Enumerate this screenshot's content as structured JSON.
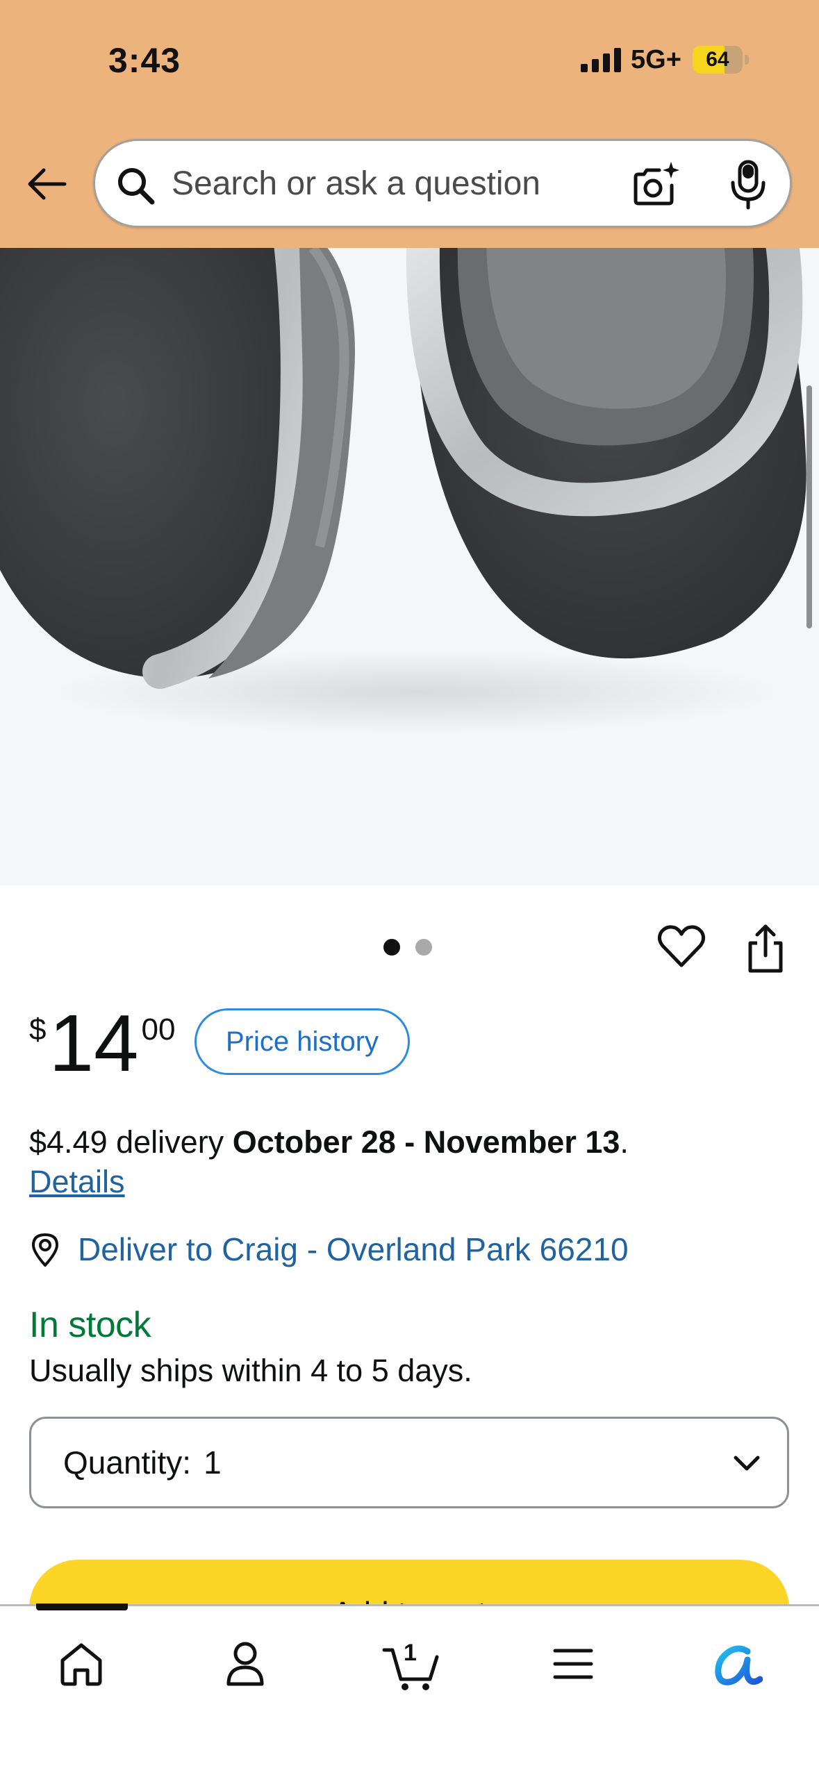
{
  "status_bar": {
    "time": "3:43",
    "network": "5G+",
    "battery": "64",
    "battery_level": 0.64
  },
  "header": {
    "back_icon": "back-arrow-icon",
    "search": {
      "placeholder": "Search or ask a question",
      "icons": [
        "search-icon",
        "camera-search-icon",
        "microphone-icon"
      ]
    }
  },
  "product": {
    "image_alt": "Gray fleece ear warmers with silver trim and faux fur lining",
    "image_count": 2,
    "active_image": 1,
    "price": {
      "symbol": "$",
      "whole": "14",
      "fraction": "00"
    },
    "price_history_label": "Price history",
    "delivery": {
      "prefix": "$4.49 delivery ",
      "dates": "October 28 - November 13",
      "suffix": ".",
      "details_label": "Details",
      "deliver_to": "Deliver to Craig - Overland Park 66210"
    },
    "stock_status": "In stock",
    "shipping_note": "Usually ships within 4 to 5 days.",
    "quantity": {
      "label": "Quantity:",
      "value": "1"
    },
    "add_to_cart_label": "Add to cart"
  },
  "bottom_nav": {
    "items": [
      "home-icon",
      "account-icon",
      "cart-icon",
      "menu-icon",
      "rufus-ai-icon"
    ],
    "cart_count": "1"
  },
  "colors": {
    "header_bg": "#edb37c",
    "link": "#2162a1",
    "in_stock": "#007a37",
    "add_to_cart": "#fcd526",
    "price_history_border": "#2b8ce0"
  }
}
